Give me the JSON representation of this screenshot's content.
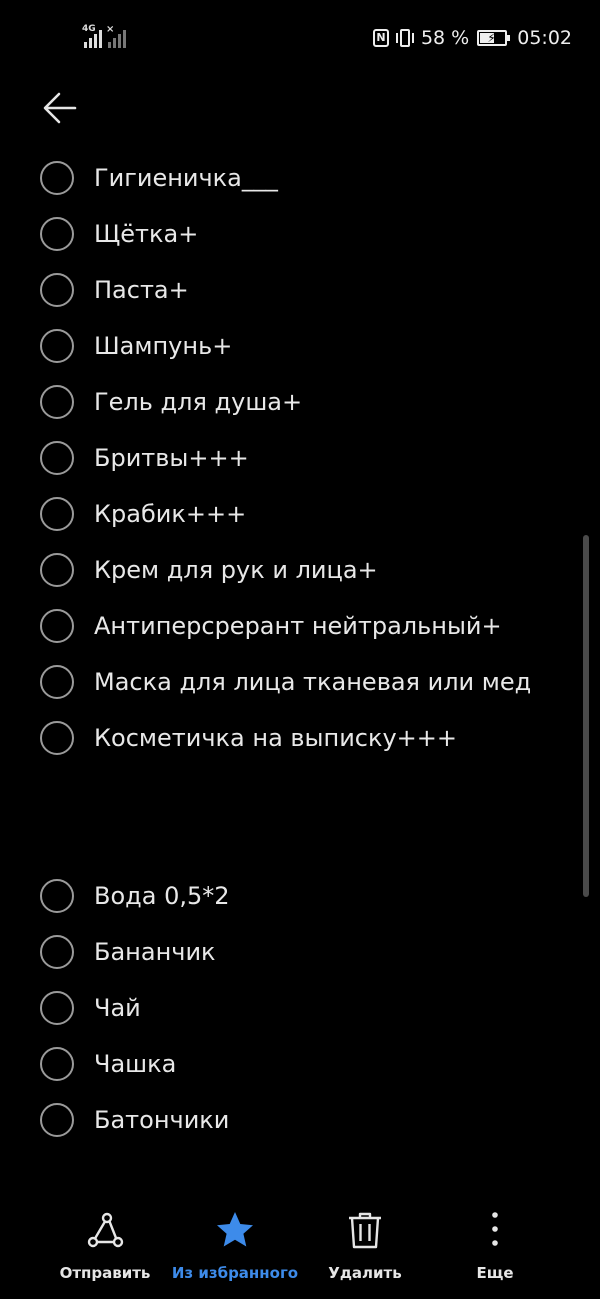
{
  "status_bar": {
    "network": "4G",
    "battery_percent_text": "58 %",
    "battery_level": 0.58,
    "time": "05:02",
    "icons": [
      "signal-icon",
      "signal-no-service-icon",
      "nfc-icon",
      "vibrate-icon",
      "battery-charging-icon"
    ]
  },
  "header": {
    "back_icon": "arrow-left-icon"
  },
  "checklist": {
    "items": [
      {
        "label": "Гигиеничка___",
        "checked": false
      },
      {
        "label": "Щётка+",
        "checked": false
      },
      {
        "label": "Паста+",
        "checked": false
      },
      {
        "label": "Шампунь+",
        "checked": false
      },
      {
        "label": "Гель для душа+",
        "checked": false
      },
      {
        "label": "Бритвы+++",
        "checked": false
      },
      {
        "label": "Крабик+++",
        "checked": false
      },
      {
        "label": "Крем для рук и лица+",
        "checked": false
      },
      {
        "label": "Антиперсрерант нейтральный+",
        "checked": false
      },
      {
        "label": "Маска для лица тканевая или мед",
        "checked": false
      },
      {
        "label": "Косметичка на выписку+++",
        "checked": false
      },
      {
        "label": "Вода 0,5*2",
        "checked": false
      },
      {
        "label": "Бананчик",
        "checked": false
      },
      {
        "label": "Чай",
        "checked": false
      },
      {
        "label": "Чашка",
        "checked": false
      },
      {
        "label": "Батончики",
        "checked": false
      }
    ]
  },
  "bottom_bar": {
    "share": {
      "label": "Отправить",
      "icon": "share-icon"
    },
    "favorite": {
      "label": "Из избранного",
      "icon": "star-icon",
      "active": true
    },
    "delete": {
      "label": "Удалить",
      "icon": "trash-icon"
    },
    "more": {
      "label": "Еще",
      "icon": "more-vertical-icon"
    }
  },
  "colors": {
    "background": "#000000",
    "text": "#e8e8e8",
    "accent": "#3d8bea",
    "checkbox": "#9a9a9a"
  }
}
